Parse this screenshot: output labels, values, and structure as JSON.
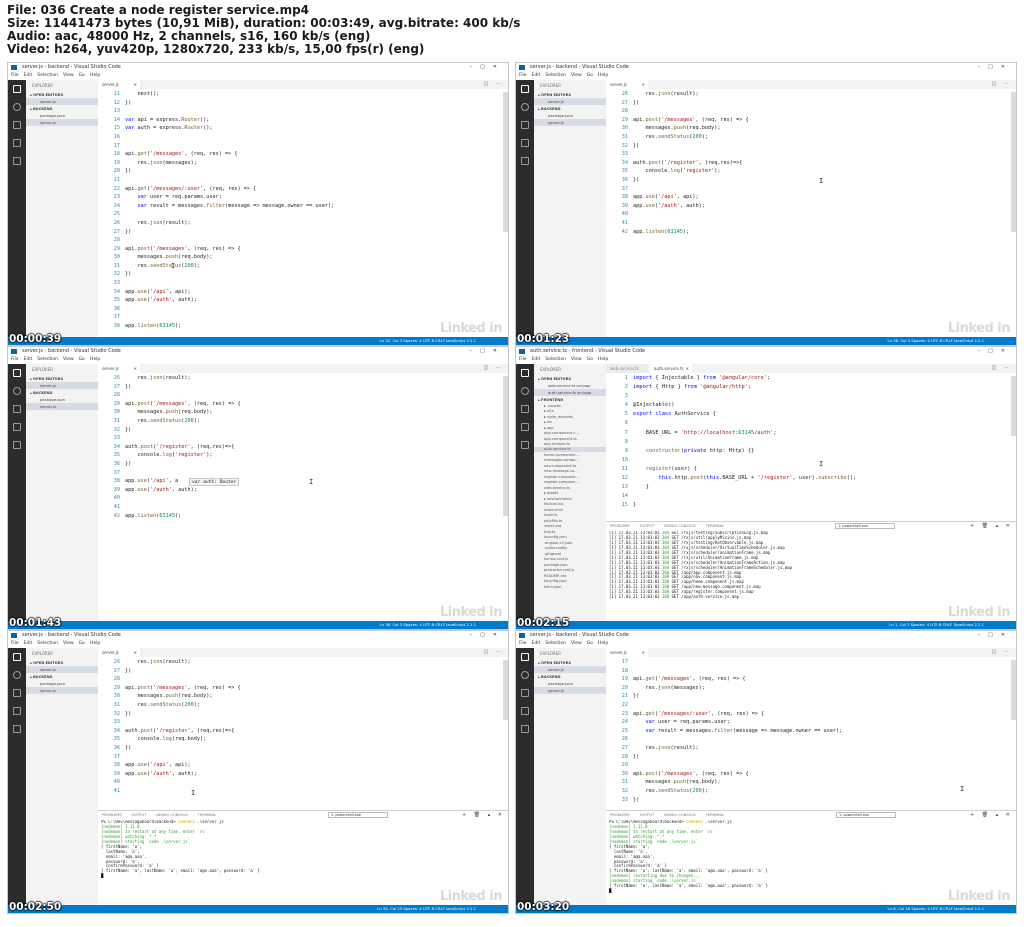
{
  "header": {
    "line1": "File: 036 Create a node register service.mp4",
    "line2": "Size: 11441473 bytes (10,91 MiB), duration: 00:03:49, avg.bitrate: 400 kb/s",
    "line3": "Audio: aac, 48000 Hz, 2 channels, s16, 160 kb/s (eng)",
    "line4": "Video: h264, yuv420p, 1280x720, 233 kb/s, 15,00 fps(r) (eng)"
  },
  "watermark": "Linked in",
  "menu": [
    "File",
    "Edit",
    "Selection",
    "View",
    "Go",
    "Help"
  ],
  "panel_tabs": [
    "PROBLEMS",
    "OUTPUT",
    "DEBUG CONSOLE",
    "TERMINAL"
  ],
  "frames": [
    {
      "timestamp": "00:00:39",
      "title": "server.js - backend - Visual Studio Code",
      "tabs": [
        {
          "label": "server.js",
          "active": true
        }
      ],
      "explorer": {
        "title": "EXPLORER",
        "open_editors": "▴ OPEN EDITORS",
        "open_files": [
          "server.js"
        ],
        "folder": "▴ BACKEND",
        "files": [
          "package.json",
          "server.js"
        ],
        "selected": "server.js"
      },
      "status": "Ln 32, Col 3   Spaces: 4   UTF-8   CRLF   JavaScript   2.2.1",
      "code": [
        {
          "n": "11",
          "t": "    next();"
        },
        {
          "n": "12",
          "t": "})"
        },
        {
          "n": "13",
          "t": ""
        },
        {
          "n": "14",
          "t": "var api = express.Router();"
        },
        {
          "n": "15",
          "t": "var auth = express.Router();"
        },
        {
          "n": "16",
          "t": ""
        },
        {
          "n": "17",
          "t": ""
        },
        {
          "n": "18",
          "t": "api.get('/messages', (req, res) => {"
        },
        {
          "n": "19",
          "t": "    res.json(messages);"
        },
        {
          "n": "20",
          "t": "})"
        },
        {
          "n": "21",
          "t": ""
        },
        {
          "n": "22",
          "t": "api.get('/messages/:user', (req, res) => {"
        },
        {
          "n": "23",
          "t": "    var user = req.params.user;"
        },
        {
          "n": "24",
          "t": "    var result = messages.filter(message => message.owner == user);"
        },
        {
          "n": "25",
          "t": ""
        },
        {
          "n": "26",
          "t": "    res.json(result);"
        },
        {
          "n": "27",
          "t": "})"
        },
        {
          "n": "28",
          "t": ""
        },
        {
          "n": "29",
          "t": "api.post('/messages', (req, res) => {"
        },
        {
          "n": "30",
          "t": "    messages.push(req.body);"
        },
        {
          "n": "31",
          "t": "    res.sendStatus(200);"
        },
        {
          "n": "32",
          "t": "})"
        },
        {
          "n": "33",
          "t": ""
        },
        {
          "n": "34",
          "t": "app.use('/api', api);"
        },
        {
          "n": "35",
          "t": "app.use('/auth', auth);"
        },
        {
          "n": "36",
          "t": ""
        },
        {
          "n": "37",
          "t": ""
        },
        {
          "n": "38",
          "t": "app.listen(63145);"
        }
      ]
    },
    {
      "timestamp": "00:01:23",
      "title": "server.js - backend - Visual Studio Code",
      "tabs": [
        {
          "label": "server.js",
          "active": true
        }
      ],
      "explorer": {
        "title": "EXPLORER",
        "open_editors": "▴ OPEN EDITORS",
        "open_files": [
          "server.js"
        ],
        "folder": "▴ BACKEND",
        "files": [
          "package.json",
          "server.js"
        ],
        "selected": "server.js"
      },
      "status": "Ln 36, Col 3   Spaces: 4   UTF-8   CRLF   JavaScript   2.2.1",
      "code": [
        {
          "n": "26",
          "t": "    res.json(result);"
        },
        {
          "n": "27",
          "t": "})"
        },
        {
          "n": "28",
          "t": ""
        },
        {
          "n": "29",
          "t": "api.post('/messages', (req, res) => {"
        },
        {
          "n": "30",
          "t": "    messages.push(req.body);"
        },
        {
          "n": "31",
          "t": "    res.sendStatus(200);"
        },
        {
          "n": "32",
          "t": "})"
        },
        {
          "n": "33",
          "t": ""
        },
        {
          "n": "34",
          "t": "auth.post('/register', (req,res)=>{"
        },
        {
          "n": "35",
          "t": "    console.log('register');"
        },
        {
          "n": "36",
          "t": "})"
        },
        {
          "n": "37",
          "t": ""
        },
        {
          "n": "38",
          "t": "app.use('/api', api);"
        },
        {
          "n": "39",
          "t": "app.use('/auth', auth);"
        },
        {
          "n": "40",
          "t": ""
        },
        {
          "n": "41",
          "t": ""
        },
        {
          "n": "42",
          "t": "app.listen(63145);"
        }
      ]
    },
    {
      "timestamp": "00:01:43",
      "title": "server.js - backend - Visual Studio Code",
      "tabs": [
        {
          "label": "server.js",
          "active": true
        }
      ],
      "explorer": {
        "title": "EXPLORER",
        "open_editors": "▴ OPEN EDITORS",
        "open_files": [
          "server.js"
        ],
        "folder": "▴ BACKEND",
        "files": [
          "package.json",
          "server.js"
        ],
        "selected": "server.js"
      },
      "status": "Ln 36, Col 3   Spaces: 4   UTF-8   CRLF   JavaScript   2.2.1",
      "tooltip": "var auth: Router",
      "code": [
        {
          "n": "26",
          "t": "    res.json(result);"
        },
        {
          "n": "27",
          "t": "})"
        },
        {
          "n": "28",
          "t": ""
        },
        {
          "n": "29",
          "t": "api.post('/messages', (req, res) => {"
        },
        {
          "n": "30",
          "t": "    messages.push(req.body);"
        },
        {
          "n": "31",
          "t": "    res.sendStatus(200);"
        },
        {
          "n": "32",
          "t": "})"
        },
        {
          "n": "33",
          "t": ""
        },
        {
          "n": "34",
          "t": "auth.post('/register', (req,res)=>{"
        },
        {
          "n": "35",
          "t": "    console.log('register');"
        },
        {
          "n": "36",
          "t": "})"
        },
        {
          "n": "37",
          "t": ""
        },
        {
          "n": "38",
          "t": "app.use('/api', a"
        },
        {
          "n": "39",
          "t": "app.use('/auth', auth);"
        },
        {
          "n": "40",
          "t": ""
        },
        {
          "n": "41",
          "t": ""
        },
        {
          "n": "42",
          "t": "app.listen(63145);"
        }
      ]
    },
    {
      "timestamp": "00:02:15",
      "title": "auth.service.ts - frontend - Visual Studio Code",
      "tabs": [
        {
          "label": "web.service.ts",
          "active": false
        },
        {
          "label": "auth.service.ts",
          "active": true
        }
      ],
      "explorer": {
        "title": "EXPLORER",
        "open_editors": "▴ OPEN EDITORS",
        "open_files": [
          "web.service.ts  src\\app",
          "auth.service.ts  src\\app"
        ],
        "folder": "▴ FRONTEND",
        "tree": [
          "▸ .vscode",
          "▸ e2e",
          "▸ node_modules",
          "▴ src",
          "  ▴ app",
          "    app.component.c...",
          "    app.component.ts",
          "    app.module.ts",
          "    auth.service.ts",
          "    home.component...",
          "    messages.compo...",
          "    nav.component.ts",
          "    new-message.co...",
          "    register.compone...",
          "    register.compone...",
          "    web.service.ts",
          "  ▸ assets",
          "  ▸ environments",
          "  favicon.ico",
          "  index.html",
          "  main.ts",
          "  polyfills.ts",
          "  styles.css",
          "  test.ts",
          "  tsconfig.json",
          "  .angular-cli.json",
          "  .editorconfig",
          "  .gitignore",
          "  karma.conf.js",
          "  package.json",
          "  protractor.conf.js",
          "  README.md",
          "  tsconfig.json",
          "  tslint.json"
        ],
        "selected": "    auth.service.ts"
      },
      "status": "Ln 1, Col 1   Spaces: 4   UTF-8   CRLF   TypeScript   2.2.1",
      "code": [
        {
          "n": "1",
          "t": "import { Injectable } from '@angular/core';"
        },
        {
          "n": "2",
          "t": "import { Http } from '@angular/http';"
        },
        {
          "n": "3",
          "t": ""
        },
        {
          "n": "4",
          "t": "@Injectable()"
        },
        {
          "n": "5",
          "t": "export class AuthService {"
        },
        {
          "n": "6",
          "t": ""
        },
        {
          "n": "7",
          "t": "    BASE_URL = 'http://localhost:63145/auth';"
        },
        {
          "n": "8",
          "t": ""
        },
        {
          "n": "9",
          "t": "    constructor(private http: Http) {}"
        },
        {
          "n": "10",
          "t": ""
        },
        {
          "n": "11",
          "t": "    register(user) {"
        },
        {
          "n": "12",
          "t": "        this.http.post(this.BASE_URL + '/register', user).subscribe();"
        },
        {
          "n": "13",
          "t": "    }"
        },
        {
          "n": "14",
          "t": ""
        },
        {
          "n": "15",
          "t": "}"
        }
      ],
      "terminal_select": "1: powershell.exe",
      "terminal": [
        "[1] 17.03.21 13:03:03 304 GET /rxjs/testing/SubscriptionLog.js.map",
        "[1] 17.03.21 13:03:03 304 GET /rxjs/util/applyMixins.js.map",
        "[1] 17.03.21 13:03:03 304 GET /rxjs/testing/HotObservable.js.map",
        "[1] 17.03.21 13:03:03 304 GET /rxjs/scheduler/VirtualTimeScheduler.js.map",
        "[1] 17.03.21 13:03:03 304 GET /rxjs/scheduler/animationFrame.js.map",
        "[1] 17.03.21 13:03:03 304 GET /rxjs/util/AnimationFrame.js.map",
        "[1] 17.03.21 13:03:03 304 GET /rxjs/scheduler/AnimationFrameAction.js.map",
        "[1] 17.03.21 13:03:03 304 GET /rxjs/scheduler/AnimationFrameScheduler.js.map",
        "[1] 17.03.21 13:03:03 200 GET /app/app.component.js.map",
        "[1] 17.03.21 13:03:03 200 GET /app/nav.component.js.map",
        "[1] 17.03.21 13:03:03 200 GET /app/home.component.js.map",
        "[1] 17.03.21 13:03:03 200 GET /app/new-message.component.js.map",
        "[1] 17.03.21 13:03:03 200 GET /app/register.component.js.map",
        "[1] 17.03.21 13:03:03 200 GET /app/auth.service.js.map"
      ]
    },
    {
      "timestamp": "00:02:50",
      "title": "server.js - backend - Visual Studio Code",
      "tabs": [
        {
          "label": "server.js",
          "active": true
        }
      ],
      "explorer": {
        "title": "EXPLORER",
        "open_editors": "▴ OPEN EDITORS",
        "open_files": [
          "server.js"
        ],
        "folder": "▴ BACKEND",
        "files": [
          "package.json",
          "server.js"
        ],
        "selected": "server.js"
      },
      "status": "Ln 35, Col 25   Spaces: 4   UTF-8   CRLF   JavaScript   2.2.1",
      "code": [
        {
          "n": "26",
          "t": "    res.json(result);"
        },
        {
          "n": "27",
          "t": "})"
        },
        {
          "n": "28",
          "t": ""
        },
        {
          "n": "29",
          "t": "api.post('/messages', (req, res) => {"
        },
        {
          "n": "30",
          "t": "    messages.push(req.body);"
        },
        {
          "n": "31",
          "t": "    res.sendStatus(200);"
        },
        {
          "n": "32",
          "t": "})"
        },
        {
          "n": "33",
          "t": ""
        },
        {
          "n": "34",
          "t": "auth.post('/register', (req,res)=>{"
        },
        {
          "n": "35",
          "t": "    console.log(req.body);"
        },
        {
          "n": "36",
          "t": "})"
        },
        {
          "n": "37",
          "t": ""
        },
        {
          "n": "38",
          "t": "app.use('/api', api);"
        },
        {
          "n": "39",
          "t": "app.use('/auth', auth);"
        },
        {
          "n": "40",
          "t": ""
        },
        {
          "n": "41",
          "t": ""
        }
      ],
      "terminal_select": "1: powershell.exe",
      "terminal": [
        "PS C:\\Dev\\messageboard\\backend> nodemon .\\server.js",
        "[nodemon] 1.11.0",
        "[nodemon] to restart at any time, enter `rs`",
        "[nodemon] watching: *.*",
        "[nodemon] starting `node .\\server.js`",
        "{ firstName: 'a',",
        "  lastName: 'a',",
        "  email: 'a@a.aaa',",
        "  password: 'a',",
        "  confirmPassword: 'a' }",
        "{ firstName: 'a', lastName: 'a', email: 'a@a.aaa', password: 'a' }",
        "█"
      ]
    },
    {
      "timestamp": "00:03:20",
      "title": "server.js - backend - Visual Studio Code",
      "tabs": [
        {
          "label": "server.js",
          "active": true
        }
      ],
      "explorer": {
        "title": "EXPLORER",
        "open_editors": "▴ OPEN EDITORS",
        "open_files": [
          "server.js"
        ],
        "folder": "▴ BACKEND",
        "files": [
          "package.json",
          "server.js"
        ],
        "selected": "server.js"
      },
      "status": "Ln 8, Col 16   Spaces: 4   UTF-8   CRLF   JavaScript   2.2.1",
      "code": [
        {
          "n": "17",
          "t": ""
        },
        {
          "n": "18",
          "t": ""
        },
        {
          "n": "19",
          "t": "api.get('/messages', (req, res) => {"
        },
        {
          "n": "20",
          "t": "    res.json(messages);"
        },
        {
          "n": "21",
          "t": "})"
        },
        {
          "n": "22",
          "t": ""
        },
        {
          "n": "23",
          "t": "api.get('/messages/:user', (req, res) => {"
        },
        {
          "n": "24",
          "t": "    var user = req.params.user;"
        },
        {
          "n": "25",
          "t": "    var result = messages.filter(message => message.owner == user);"
        },
        {
          "n": "26",
          "t": ""
        },
        {
          "n": "27",
          "t": "    res.json(result);"
        },
        {
          "n": "28",
          "t": "})"
        },
        {
          "n": "29",
          "t": ""
        },
        {
          "n": "30",
          "t": "api.post('/messages', (req, res) => {"
        },
        {
          "n": "31",
          "t": "    messages.push(req.body);"
        },
        {
          "n": "32",
          "t": "    res.sendStatus(200);"
        },
        {
          "n": "33",
          "t": "})"
        }
      ],
      "terminal_select": "1: powershell.exe",
      "terminal": [
        "PS C:\\Dev\\messageboard\\backend> nodemon .\\server.js",
        "[nodemon] 1.11.0",
        "[nodemon] to restart at any time, enter `rs`",
        "[nodemon] watching: *.*",
        "[nodemon] starting `node .\\server.js`",
        "{ firstName: 'a',",
        "  lastName: 'a',",
        "  email: 'a@a.aaa',",
        "  password: 'a',",
        "  confirmPassword: 'a' }",
        "{ firstName: 'a', lastName: 'a', email: 'a@a.aaa', password: 'a' }",
        "[nodemon] restarting due to changes...",
        "[nodemon] starting `node .\\server.js`",
        "{ firstName: 'a', lastName: 'a', email: 'a@a.aaa', password: 'a' }",
        "█"
      ]
    }
  ]
}
